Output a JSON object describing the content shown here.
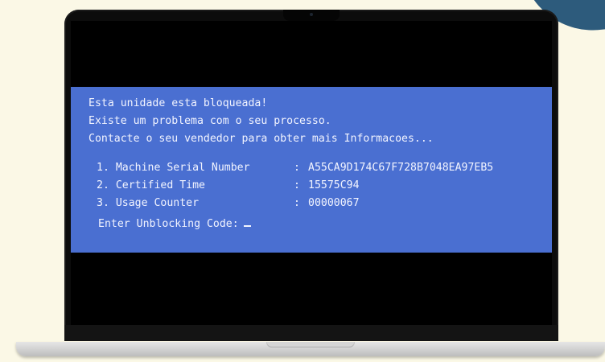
{
  "bsod": {
    "line1": "Esta unidade esta bloqueada!",
    "line2": "Existe um problema com o seu processo.",
    "line3": "Contacte o seu vendedor para obter mais Informacoes...",
    "items": [
      {
        "label": "1. Machine Serial Number",
        "sep": ":",
        "value": "A55CA9D174C67F728B7048EA97EB5"
      },
      {
        "label": "2. Certified Time",
        "sep": ":",
        "value": "15575C94"
      },
      {
        "label": "3. Usage Counter",
        "sep": ":",
        "value": "00000067"
      }
    ],
    "unlock_prompt": "Enter Unblocking Code:"
  },
  "colors": {
    "background": "#fbf8e6",
    "panel_blue": "#4a6fd1",
    "corner_accent": "#2d5b7c",
    "laptop_lid": "#0c0c0c",
    "laptop_base": "#cfcfcf"
  },
  "icons": {
    "camera": "camera-icon",
    "cursor": "text-cursor-icon"
  }
}
